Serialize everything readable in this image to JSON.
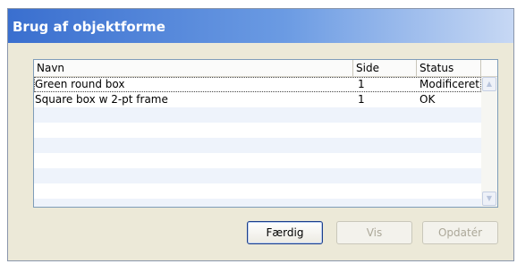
{
  "window": {
    "title": "Brug af objektforme"
  },
  "table": {
    "columns": [
      "Navn",
      "Side",
      "Status"
    ],
    "rows": [
      {
        "name": "Green round box",
        "side": "1",
        "status": "Modificeret"
      },
      {
        "name": "Square box w 2-pt frame",
        "side": "1",
        "status": "OK"
      }
    ]
  },
  "buttons": {
    "done": "Færdig",
    "show": "Vis",
    "update": "Opdatér"
  },
  "icons": {
    "scroll_up": "scroll-up-icon",
    "scroll_down": "scroll-down-icon"
  }
}
